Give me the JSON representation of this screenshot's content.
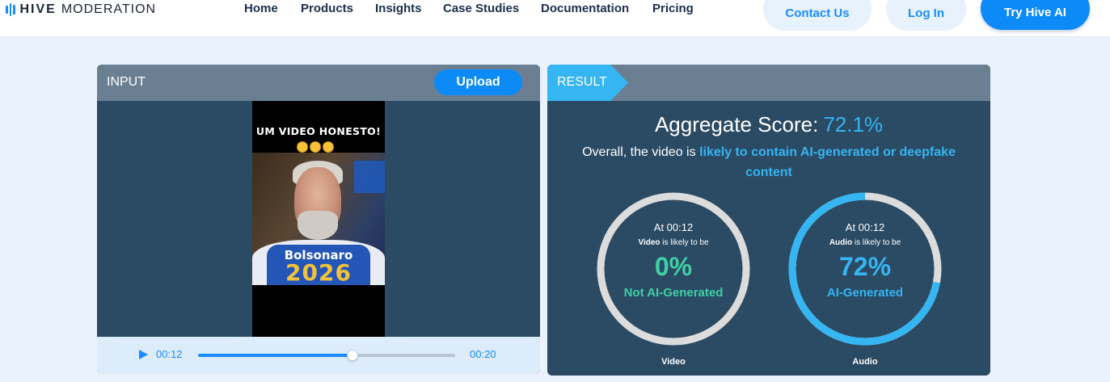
{
  "nav": {
    "brand_bold": "HIVE",
    "brand_light": "MODERATION",
    "links": [
      "Home",
      "Products",
      "Insights",
      "Case Studies",
      "Documentation",
      "Pricing"
    ],
    "contact": "Contact Us",
    "login": "Log In",
    "try": "Try Hive AI"
  },
  "input": {
    "label": "INPUT",
    "upload": "Upload",
    "video": {
      "caption": "UM VIDEO HONESTO!",
      "shirt_line1": "Bolsonaro",
      "shirt_line2": "2026"
    },
    "player": {
      "current_time": "00:12",
      "total_time": "00:20",
      "progress": 0.6
    }
  },
  "result": {
    "label": "RESULT",
    "aggregate_label": "Aggregate Score:",
    "aggregate_value": "72.1%",
    "overall_prefix": "Overall, the video is",
    "overall_highlight": "likely to contain AI-generated or deepfake content",
    "gauges": [
      {
        "at": "At 00:12",
        "subject": "Video",
        "likely": "is likely to be",
        "percent": "0%",
        "fraction": 0.0,
        "classification": "Not AI-Generated",
        "caption": "Video",
        "color": "#3fd0a6"
      },
      {
        "at": "At 00:12",
        "subject": "Audio",
        "likely": "is likely to be",
        "percent": "72%",
        "fraction": 0.72,
        "classification": "AI-Generated",
        "caption": "Audio",
        "color": "#35b5f2"
      }
    ]
  },
  "colors": {
    "accent": "#0b8af8",
    "highlight": "#35b5f2",
    "panel": "#2b4a63",
    "panel_header": "#6b7f93",
    "ring_track": "#dcdcdc",
    "not_ai": "#3fd0a6"
  }
}
